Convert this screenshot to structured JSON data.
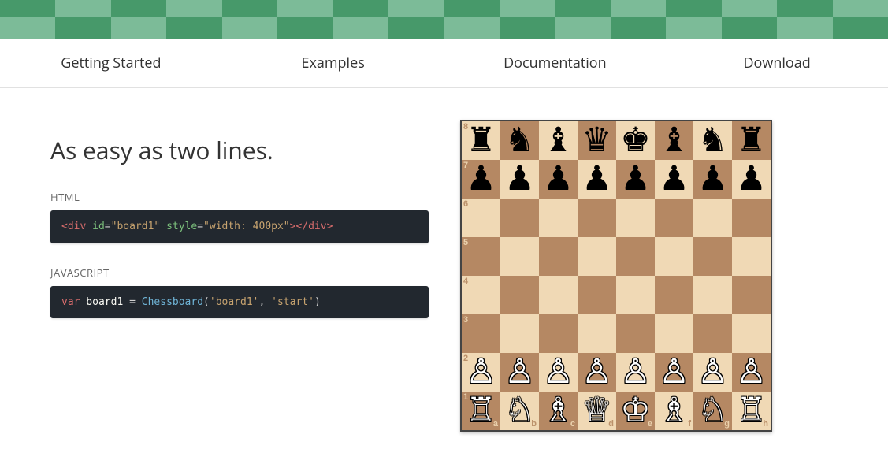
{
  "hero": {
    "rows": 2,
    "cols": 16
  },
  "nav": [
    {
      "id": "getting-started",
      "label": "Getting Started"
    },
    {
      "id": "examples",
      "label": "Examples"
    },
    {
      "id": "documentation",
      "label": "Documentation"
    },
    {
      "id": "download",
      "label": "Download"
    }
  ],
  "headline": "As easy as two lines.",
  "snippets": {
    "html": {
      "label": "HTML",
      "tokens": [
        {
          "t": "<div",
          "c": "tok-tag"
        },
        {
          "t": " ",
          "c": ""
        },
        {
          "t": "id",
          "c": "tok-attr"
        },
        {
          "t": "=",
          "c": "tok-punc"
        },
        {
          "t": "\"board1\"",
          "c": "tok-string"
        },
        {
          "t": " ",
          "c": ""
        },
        {
          "t": "style",
          "c": "tok-attr"
        },
        {
          "t": "=",
          "c": "tok-punc"
        },
        {
          "t": "\"width: 400px\"",
          "c": "tok-string"
        },
        {
          "t": ">",
          "c": "tok-tag"
        },
        {
          "t": "</div>",
          "c": "tok-tag"
        }
      ]
    },
    "js": {
      "label": "JAVASCRIPT",
      "tokens": [
        {
          "t": "var",
          "c": "tok-keyword"
        },
        {
          "t": " board1 ",
          "c": "tok-ident"
        },
        {
          "t": "=",
          "c": "tok-punc"
        },
        {
          "t": " ",
          "c": ""
        },
        {
          "t": "Chessboard",
          "c": "tok-type"
        },
        {
          "t": "(",
          "c": "tok-punc"
        },
        {
          "t": "'board1'",
          "c": "tok-string"
        },
        {
          "t": ", ",
          "c": "tok-punc"
        },
        {
          "t": "'start'",
          "c": "tok-string"
        },
        {
          "t": ")",
          "c": "tok-punc"
        }
      ]
    }
  },
  "board": {
    "ranks": [
      "8",
      "7",
      "6",
      "5",
      "4",
      "3",
      "2",
      "1"
    ],
    "files": [
      "a",
      "b",
      "c",
      "d",
      "e",
      "f",
      "g",
      "h"
    ],
    "pieces": {
      "glyph": {
        "K": "♔",
        "Q": "♕",
        "R": "♖",
        "B": "♗",
        "N": "♘",
        "P": "♙",
        "k": "♚",
        "q": "♛",
        "r": "♜",
        "b": "♝",
        "n": "♞",
        "p": "♟"
      },
      "rows": [
        [
          "r",
          "n",
          "b",
          "q",
          "k",
          "b",
          "n",
          "r"
        ],
        [
          "p",
          "p",
          "p",
          "p",
          "p",
          "p",
          "p",
          "p"
        ],
        [
          "",
          "",
          "",
          "",
          "",
          "",
          "",
          ""
        ],
        [
          "",
          "",
          "",
          "",
          "",
          "",
          "",
          ""
        ],
        [
          "",
          "",
          "",
          "",
          "",
          "",
          "",
          ""
        ],
        [
          "",
          "",
          "",
          "",
          "",
          "",
          "",
          ""
        ],
        [
          "P",
          "P",
          "P",
          "P",
          "P",
          "P",
          "P",
          "P"
        ],
        [
          "R",
          "N",
          "B",
          "Q",
          "K",
          "B",
          "N",
          "R"
        ]
      ]
    }
  }
}
